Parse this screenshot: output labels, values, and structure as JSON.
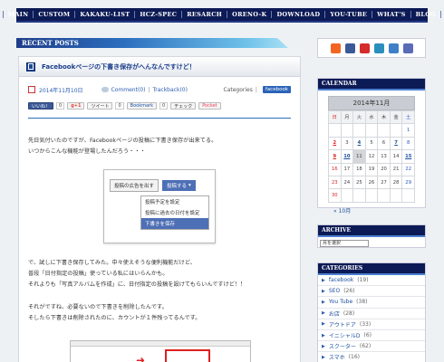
{
  "nav": [
    "MAIN",
    "CUSTOM",
    "KAKAKU-LIST",
    "HCZ-SPEC",
    "RESARCH",
    "ORENO-K",
    "DOWNLOAD",
    "YOU-TUBE",
    "WHAT'S",
    "BLOG"
  ],
  "recent_posts_title": "RECENT POSTS",
  "post": {
    "title": "Facebookページの下書き保存がへんなんですけど！",
    "date": "2014年11月10日",
    "comments": "Comment(0)",
    "trackbacks": "Trackback(0)",
    "categories_label": "Categories",
    "category": "facebook",
    "share": {
      "like": "いいね！",
      "like_count": "0",
      "gplus": "g+1",
      "tweet": "ツイート",
      "tweet_count": "0",
      "bookmark": "Bookmark",
      "bookmark_count": "0",
      "check": "チェック",
      "pocket": "Pocket"
    },
    "para1": [
      "先日気付いたのですが、Facebookページの投稿に下書き保存が出来てる。",
      "いつからこんな機能が登場したんだろう・・・"
    ],
    "screenshot": {
      "ad_button": "投稿の広告を出す",
      "post_button": "投稿する",
      "menu": [
        "投稿予定を設定",
        "投稿に過去の日付を設定",
        "下書きを保存"
      ]
    },
    "para2": [
      "で、試しに下書き保存してみた。中々使えそうな便利機能だけど、",
      "普段「日付指定の投稿」使っている私にはいらんかも。",
      "それよりも「写真アルバムを作成」に、日付指定の投稿を設けてもらいんですけど！！"
    ],
    "para3": [
      "それがですね、必要ないので下書きを削除したんです。",
      "そしたら下書きは削除されたのに、カウントが１件残ってるんです。"
    ]
  },
  "sidebar": {
    "calendar_title": "CALENDAR",
    "month": "2014年11月",
    "weekdays": [
      "日",
      "月",
      "火",
      "水",
      "木",
      "金",
      "土"
    ],
    "weeks": [
      [
        "",
        "",
        "",
        "",
        "",
        "",
        "1"
      ],
      [
        "2",
        "3",
        "4",
        "5",
        "6",
        "7",
        "8"
      ],
      [
        "9",
        "10",
        "11",
        "12",
        "13",
        "14",
        "15"
      ],
      [
        "16",
        "17",
        "18",
        "19",
        "20",
        "21",
        "22"
      ],
      [
        "23",
        "24",
        "25",
        "26",
        "27",
        "28",
        "29"
      ],
      [
        "30",
        "",
        "",
        "",
        "",
        "",
        ""
      ]
    ],
    "linked_days": [
      "2",
      "4",
      "7",
      "9",
      "10",
      "15"
    ],
    "today": "11",
    "prev_month": "« 10月",
    "archive_title": "ARCHIVE",
    "archive_select": "月を選択",
    "categories_title": "CATEGORIES",
    "categories": [
      {
        "name": "facebook",
        "count": "(19)"
      },
      {
        "name": "SEO",
        "count": "(26)"
      },
      {
        "name": "You Tube",
        "count": "(38)"
      },
      {
        "name": "お店",
        "count": "(28)"
      },
      {
        "name": "アウトドア",
        "count": "(33)"
      },
      {
        "name": "イニシャルD",
        "count": "(6)"
      },
      {
        "name": "スクーター",
        "count": "(62)"
      },
      {
        "name": "スマホ",
        "count": "(16)"
      }
    ],
    "social_icons": [
      "rss-icon",
      "facebook-icon",
      "youtube-icon",
      "home-icon",
      "chat-icon",
      "mixi-icon"
    ],
    "social_colors": [
      "#f26522",
      "#3b5998",
      "#d52b2b",
      "#2a8fbd",
      "#3f7fc8",
      "#5a6bb8"
    ]
  }
}
